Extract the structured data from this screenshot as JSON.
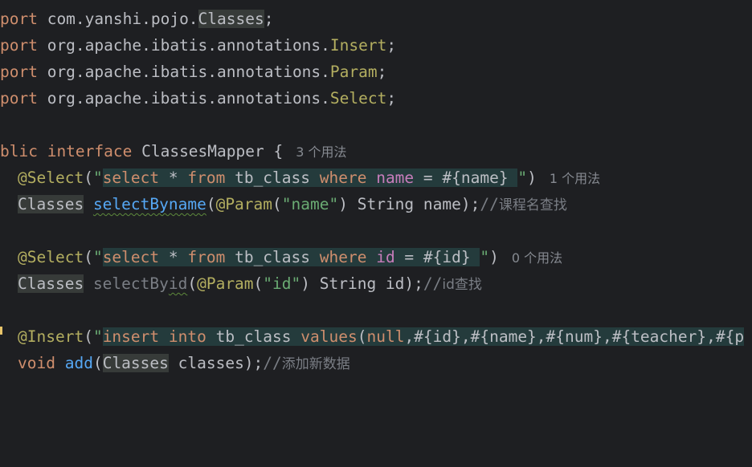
{
  "lines": {
    "l1": {
      "a": "port ",
      "b": "com.yanshi.pojo.",
      "c": "Classes",
      "d": ";"
    },
    "l2": {
      "a": "port ",
      "b": "org.apache.ibatis.annotations.",
      "c": "Insert",
      "d": ";"
    },
    "l3": {
      "a": "port ",
      "b": "org.apache.ibatis.annotations.",
      "c": "Param",
      "d": ";"
    },
    "l4": {
      "a": "port ",
      "b": "org.apache.ibatis.annotations.",
      "c": "Select",
      "d": ";"
    },
    "l5": {
      "a": "blic ",
      "b": "interface ",
      "c": "ClassesMapper {",
      "hint": "3 个用法"
    },
    "l6": {
      "ann": "@Select",
      "p1": "(",
      "q1": "\"",
      "s1": "select",
      "s2": " * ",
      "s3": "from",
      "s4": " tb_class ",
      "s5": "where",
      "s6": " ",
      "s7": "name",
      "s8": " = #{name} ",
      "q2": "\"",
      "p2": ")",
      "hint": "1 个用法"
    },
    "l7": {
      "type": "Classes",
      "sp": " ",
      "fn": "selectByname",
      "p1": "(",
      "ann": "@Param",
      "p2": "(",
      "str": "\"name\"",
      "rest": ") String name);",
      "cmt1": "//",
      "cmt2": "课程名查找"
    },
    "l9": {
      "ann": "@Select",
      "p1": "(",
      "q1": "\"",
      "s1": "select",
      "s2": " * ",
      "s3": "from",
      "s4": " tb_class ",
      "s5": "where",
      "s6": " ",
      "s7": "id",
      "s8": " = #{id} ",
      "q2": "\"",
      "p2": ")",
      "hint": "0 个用法"
    },
    "l10": {
      "type": "Classes",
      "sp": " ",
      "fn1": "selectBy",
      "fn2": "id",
      "p1": "(",
      "ann": "@Param",
      "p2": "(",
      "str": "\"id\"",
      "rest": ") String id);",
      "cmt1": "//",
      "cmt2": "id查找"
    },
    "l12": {
      "ann": "@Insert",
      "p1": "(",
      "q1": "\"",
      "s1": "insert",
      "s2": " ",
      "s3": "into",
      "s4": " tb_class ",
      "s5": "values",
      "s6": "(",
      "s7": "null",
      "s8": ",#{id},#{name},#{num},#{teacher},#{p"
    },
    "l13": {
      "kw": "void",
      "sp": " ",
      "fn": "add",
      "p1": "(",
      "type": "Classes",
      "rest": " classes);",
      "cmt1": "//",
      "cmt2": "添加新数据"
    }
  },
  "colors": {
    "background": "#1e1f22",
    "keyword": "#cf8e6d",
    "annotation": "#b3ae60",
    "string": "#6aab73",
    "method": "#56a8f5",
    "comment": "#7a7e85",
    "field": "#c77dbb",
    "sql_bg": "#243b3c"
  }
}
